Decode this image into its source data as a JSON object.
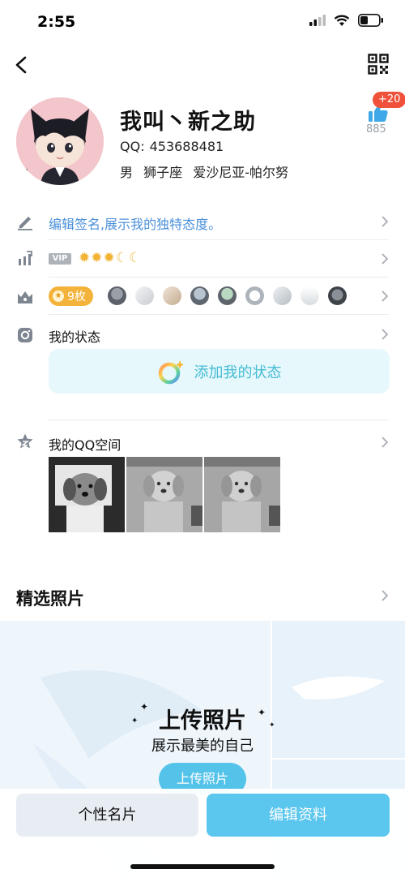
{
  "status_bar": {
    "time": "2:55"
  },
  "profile": {
    "nickname": "我叫丶新之助",
    "qq_label": "QQ:",
    "qq_number": "453688481",
    "gender": "男",
    "zodiac": "狮子座",
    "location": "爱沙尼亚-帕尔努",
    "like_badge": "+20",
    "like_count": "885"
  },
  "signature": {
    "text": "编辑签名,展示我的独特态度。"
  },
  "vip": {
    "tag": "VIP",
    "level_icons": [
      "sun",
      "sun",
      "sun",
      "moon",
      "moon"
    ]
  },
  "medals": {
    "count_label": "9枚"
  },
  "my_status": {
    "title": "我的状态",
    "add_label": "添加我的状态"
  },
  "qzone": {
    "title": "我的QQ空间"
  },
  "featured_photos": {
    "title": "精选照片",
    "upload_title": "上传照片",
    "upload_subtitle": "展示最美的自己",
    "upload_button": "上传照片"
  },
  "bottom_actions": {
    "card_label": "个性名片",
    "edit_label": "编辑资料"
  },
  "colors": {
    "accent_blue": "#5bc6ee",
    "signature_blue": "#4a90d9",
    "badge_red": "#f0513b",
    "medal_gold": "#f3b33a"
  }
}
